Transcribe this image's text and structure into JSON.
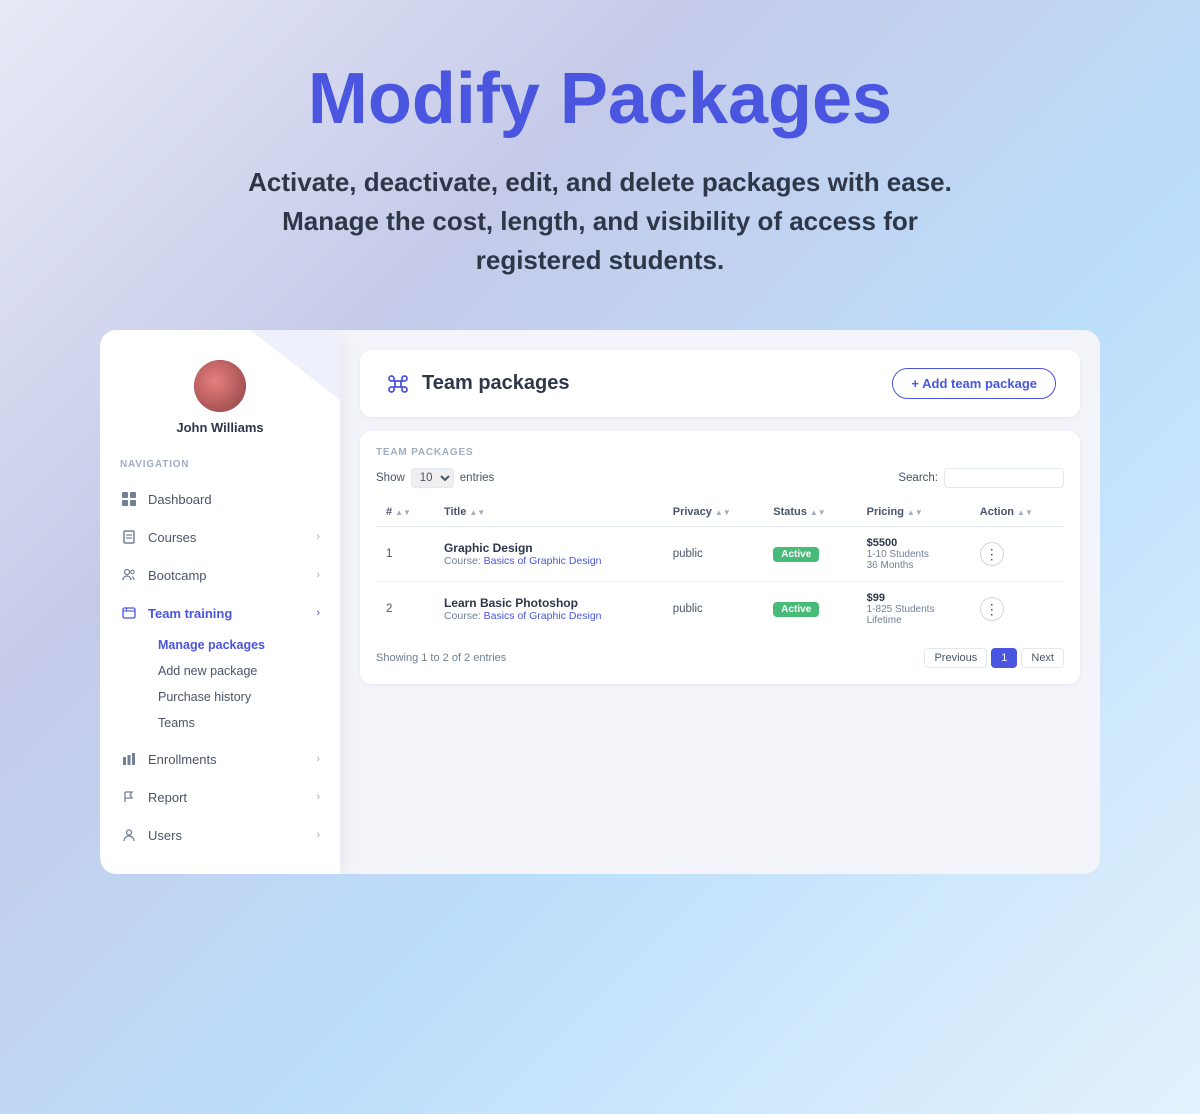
{
  "hero": {
    "title": "Modify Packages",
    "subtitle": "Activate, deactivate, edit, and delete packages with ease. Manage the cost, length, and visibility of access for registered students."
  },
  "sidebar": {
    "profile": {
      "name": "John Williams"
    },
    "nav_section_label": "NAVIGATION",
    "items": [
      {
        "id": "dashboard",
        "label": "Dashboard",
        "icon": "grid",
        "has_children": false
      },
      {
        "id": "courses",
        "label": "Courses",
        "icon": "book",
        "has_children": true
      },
      {
        "id": "bootcamp",
        "label": "Bootcamp",
        "icon": "users",
        "has_children": true
      },
      {
        "id": "team-training",
        "label": "Team training",
        "icon": "file",
        "has_children": true,
        "active": true
      },
      {
        "id": "enrollments",
        "label": "Enrollments",
        "icon": "chart",
        "has_children": true
      },
      {
        "id": "report",
        "label": "Report",
        "icon": "flag",
        "has_children": true
      },
      {
        "id": "users",
        "label": "Users",
        "icon": "person",
        "has_children": true
      }
    ],
    "sub_items": [
      {
        "id": "manage-packages",
        "label": "Manage packages",
        "active": true
      },
      {
        "id": "add-new-package",
        "label": "Add new package",
        "active": false
      },
      {
        "id": "purchase-history",
        "label": "Purchase history",
        "active": false
      },
      {
        "id": "teams",
        "label": "Teams",
        "active": false
      }
    ]
  },
  "main": {
    "header": {
      "icon": "command",
      "title": "Team packages",
      "add_button": "+ Add team package"
    },
    "table_section_label": "TEAM PACKAGES",
    "controls": {
      "show_label": "Show",
      "show_value": "10",
      "entries_label": "entries",
      "search_label": "Search:",
      "search_value": ""
    },
    "columns": [
      {
        "label": "#"
      },
      {
        "label": "Title"
      },
      {
        "label": "Privacy"
      },
      {
        "label": "Status"
      },
      {
        "label": "Pricing"
      },
      {
        "label": "Action"
      }
    ],
    "rows": [
      {
        "num": "1",
        "title": "Graphic Design",
        "course_label": "Course:",
        "course_link": "Basics of Graphic Design",
        "privacy": "public",
        "status": "Active",
        "pricing_price": "$5500",
        "pricing_students": "1-10 Students",
        "pricing_duration": "36 Months"
      },
      {
        "num": "2",
        "title": "Learn Basic Photoshop",
        "course_label": "Course:",
        "course_link": "Basics of Graphic Design",
        "privacy": "public",
        "status": "Active",
        "pricing_price": "$99",
        "pricing_students": "1-825 Students",
        "pricing_duration": "Lifetime"
      }
    ],
    "footer": {
      "showing": "Showing 1 to 2 of 2 entries",
      "prev": "Previous",
      "page": "1",
      "next": "Next"
    }
  }
}
